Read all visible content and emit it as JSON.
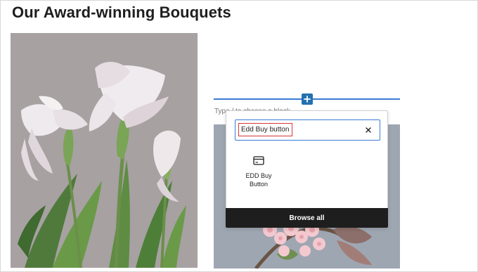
{
  "page": {
    "title": "Our Award-winning Bouquets"
  },
  "editor": {
    "placeholder": "Type / to choose a block",
    "inserter_icon": "plus-icon"
  },
  "inserter": {
    "search_value": "Edd Buy button",
    "clear_icon": "close-icon",
    "results": [
      {
        "label": "EDD Buy Button",
        "icon": "credit-card-icon"
      }
    ],
    "browse_all_label": "Browse all"
  },
  "colors": {
    "accent": "#3a7bd5",
    "highlight": "#d63638",
    "dark": "#1e1e1e"
  }
}
